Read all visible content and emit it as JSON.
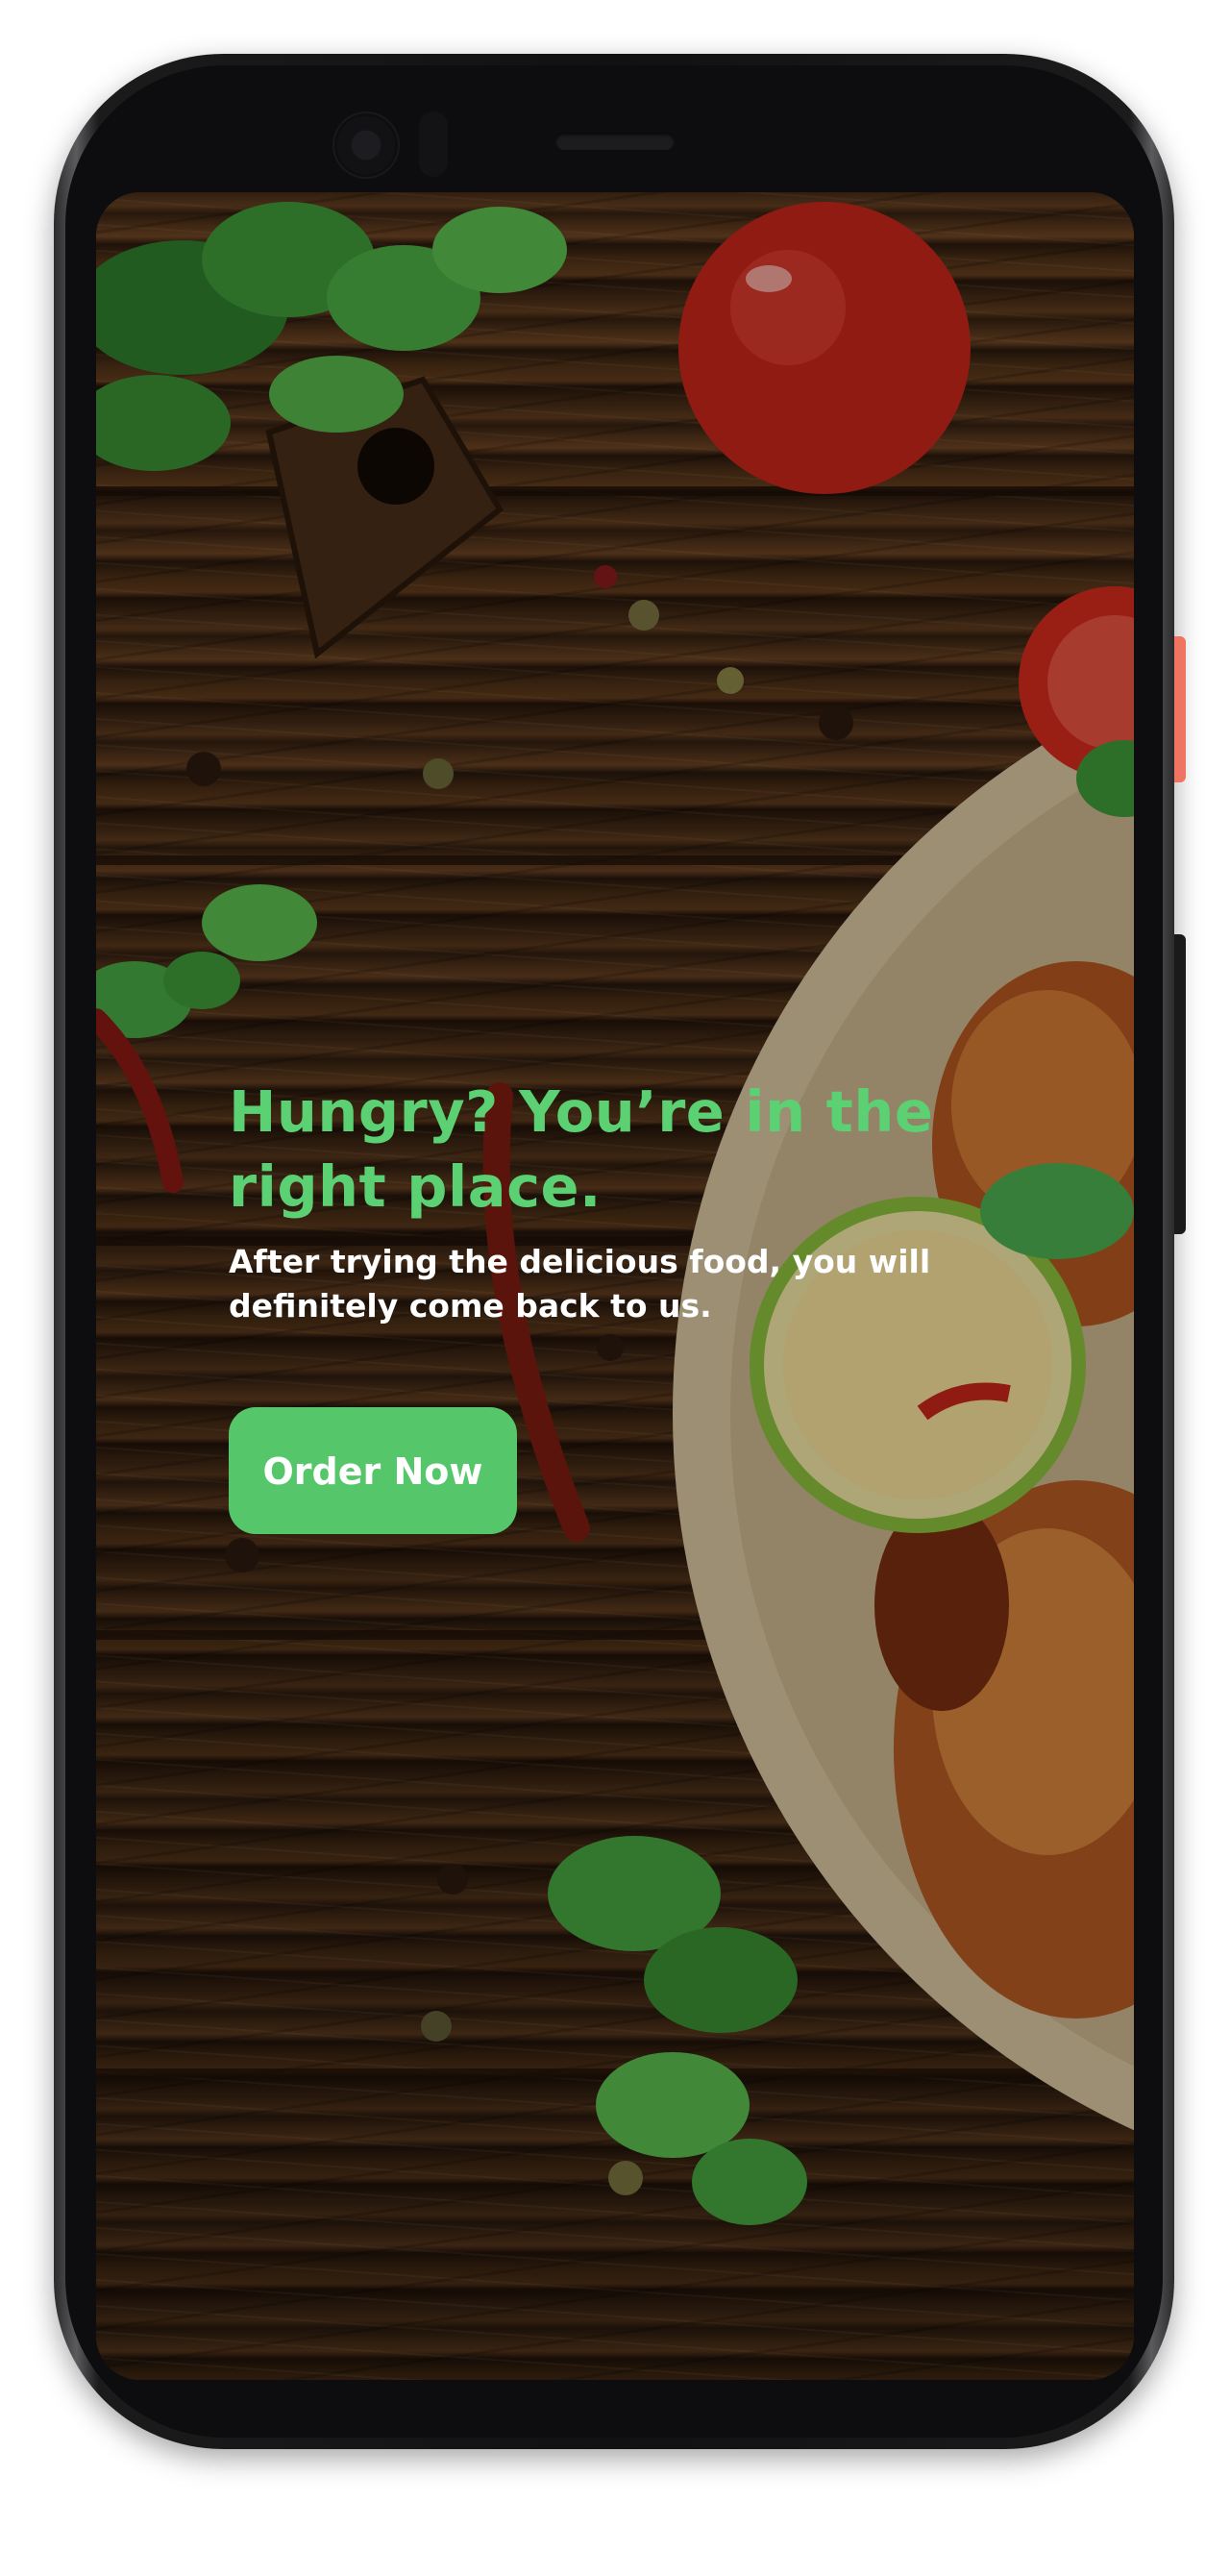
{
  "hero": {
    "title": "Hungry? You’re in the right place.",
    "subtitle": "After trying the delicious food, you will definitely come back to us.",
    "cta_label": "Order Now"
  },
  "colors": {
    "accent_green": "#5bd173",
    "button_green": "#55c76a",
    "subtitle_text": "#ffffff",
    "phone_power_button": "#ef7461"
  },
  "background": {
    "icons": [
      "wood-table-image",
      "parsley-icon",
      "tomato-icon",
      "chili-pepper-icon",
      "lime-slice-icon",
      "roast-chicken-plate-icon",
      "peppercorn-icon"
    ]
  }
}
